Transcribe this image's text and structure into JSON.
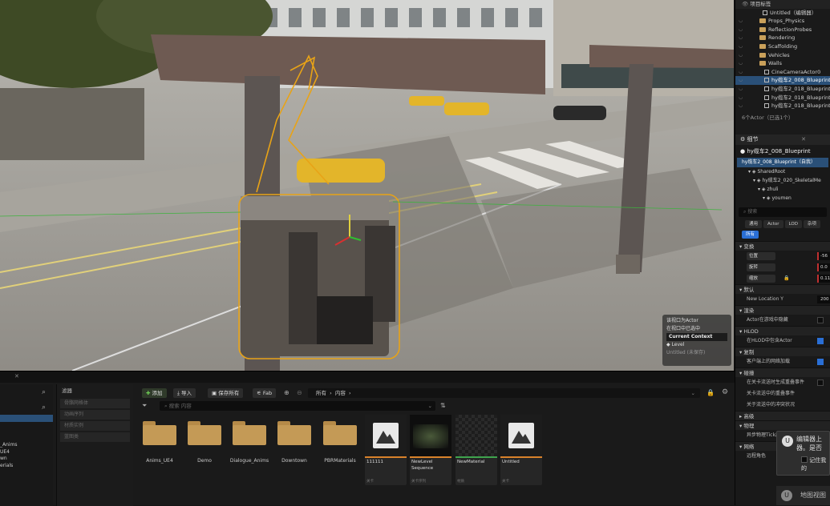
{
  "viewport": {
    "overlay": {
      "line1": "该视口为Actor",
      "line2": "在视口中已选中",
      "current_context": "Current Context",
      "level_label": "Level",
      "level_value": "Untitled (未保存)"
    }
  },
  "outliner": {
    "header": "项目标签",
    "rows": [
      {
        "label": "Untitled（编辑器）",
        "icon": "level-icon",
        "selected": false
      },
      {
        "label": "Props_Physics",
        "icon": "folder-icon",
        "selected": false
      },
      {
        "label": "ReflectionProbes",
        "icon": "folder-icon",
        "selected": false
      },
      {
        "label": "Rendering",
        "icon": "folder-icon",
        "selected": false
      },
      {
        "label": "Scaffolding",
        "icon": "folder-icon",
        "selected": false
      },
      {
        "label": "Vehicles",
        "icon": "folder-icon",
        "selected": false
      },
      {
        "label": "Walls",
        "icon": "folder-icon",
        "selected": false
      },
      {
        "label": "CineCameraActor0",
        "icon": "camera-icon",
        "selected": false
      },
      {
        "label": "hy缆车2_008_Blueprint",
        "icon": "actor-icon",
        "selected": true
      },
      {
        "label": "hy缆车2_018_Blueprint",
        "icon": "actor-icon",
        "selected": false
      },
      {
        "label": "hy缆车2_018_Blueprint3",
        "icon": "actor-icon",
        "selected": false
      },
      {
        "label": "hy缆车2_018_Blueprint3",
        "icon": "actor-icon",
        "selected": false
      }
    ],
    "status": "6个Actor（已选1个）"
  },
  "details": {
    "tab_title": "细节",
    "object_name": "hy缆车2_008_Blueprint",
    "instance_label": "hy缆车2_008_Blueprint（自我）",
    "components": [
      "SharedRoot",
      "hy缆车2_020_SkeletalMe",
      "zhuli",
      "youmen"
    ],
    "search_placeholder": "搜索",
    "filter_tabs": [
      "通用",
      "Actor",
      "LOD",
      "杂项",
      "所有"
    ],
    "transform_section": "变换",
    "transform": [
      {
        "label": "位置",
        "value": "-56"
      },
      {
        "label": "旋转",
        "value": "0.0"
      },
      {
        "label": "缩放",
        "value": "0.11"
      }
    ],
    "default_section": "默认",
    "new_location_label": "New Location Y",
    "new_location_value": "200",
    "rendering_section": "渲染",
    "hidden_in_game": "Actor在游戏中隐藏",
    "hlod_section": "HLOD",
    "include_hlod": "在HLOD中包含Actor",
    "replication_section": "复制",
    "client_net_load": "客户端上的网络加载",
    "collision_section": "碰撞",
    "overlap_events": "在关卡流送时生成重叠事件",
    "collision_a": "关卡流送中的重叠事件",
    "collision_b": "关于流送中的冲突状况",
    "advanced_section": "高级",
    "physics_section": "物理",
    "async_tick": "异步物理Tick启用",
    "network_section": "网络",
    "remote_role": "远程角色"
  },
  "toast": {
    "title": "编辑器上",
    "body": "器。是否",
    "checkbox_label": "记住我的",
    "footer": "地图视图"
  },
  "content_browser": {
    "filters_header": "滤器",
    "filters": [
      "骨骼网格体",
      "动画序列",
      "材质实例",
      "蓝图类"
    ],
    "left_tree": [
      "_Anims",
      "UE4",
      "wn",
      "erials"
    ],
    "add_label": "添加",
    "import_label": "导入",
    "save_all_label": "保存所有",
    "fab_label": "Fab",
    "path": [
      "所有",
      "内容"
    ],
    "search_placeholder": "搜索 内容",
    "folders": [
      "Anims_UE4",
      "Demo",
      "Dialogue_Anims",
      "Downtown",
      "PBRMaterials"
    ],
    "assets": [
      {
        "name": "111111",
        "type": "关卡",
        "bar": "#d9822b",
        "thumb": "mountain-icon"
      },
      {
        "name": "NewLevel Sequence",
        "type": "关卡序列",
        "bar": "#d9822b",
        "thumb": "sequence-preview"
      },
      {
        "name": "NewMaterial",
        "type": "材质",
        "bar": "#3fa34d",
        "thumb": "checker-preview"
      },
      {
        "name": "Untitled",
        "type": "关卡",
        "bar": "#d9822b",
        "thumb": "mountain-icon"
      }
    ]
  },
  "colors": {
    "accent": "#2a6fd6",
    "selection": "#2a5078",
    "folder": "#c49a56",
    "highlight_outline": "#e8a317"
  }
}
